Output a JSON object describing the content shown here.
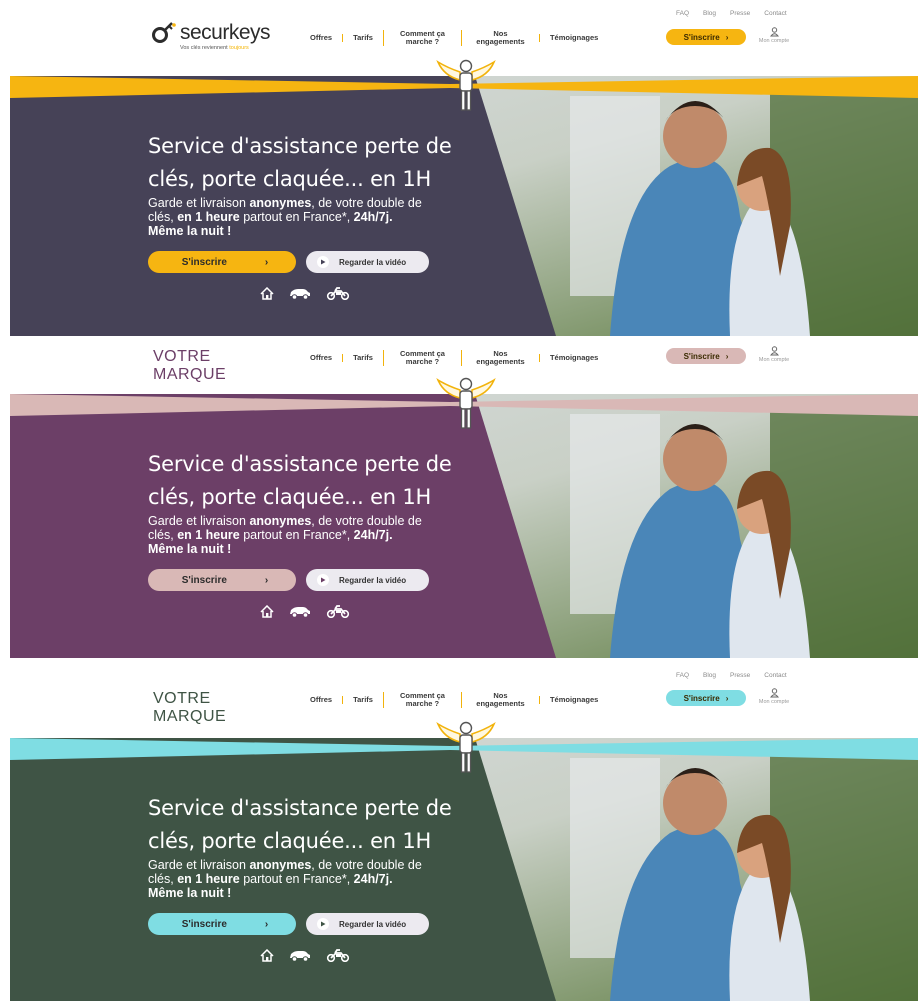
{
  "panels": [
    {
      "id": "securkeys",
      "accent": "#f6b511",
      "hero_bg": "#464257",
      "topnav": [
        "FAQ",
        "Blog",
        "Presse",
        "Contact"
      ],
      "logo": {
        "word": "securkeys",
        "tagline": "Vos clés reviennent",
        "tagline_accent": "toujours"
      },
      "nav": [
        "Offres",
        "Tarifs",
        "Comment ça marche ?",
        "Nos engagements",
        "Témoignages"
      ],
      "cta": "S'inscrire",
      "cta_arrow": "›",
      "account": "Mon compte",
      "hero": {
        "title_line1": "Service d'assistance perte de",
        "title_line2": "clés, porte claquée... en 1H",
        "sub_a": "Garde et livraison ",
        "sub_b": "anonymes",
        "sub_c": ", de votre double de",
        "sub_d": "clés, ",
        "sub_e": "en 1 heure",
        "sub_f": " partout en France*, ",
        "sub_g": "24h/7j.",
        "sub_h": "Même la nuit !",
        "btn_signup": "S'inscrire",
        "btn_signup_arrow": "›",
        "btn_video": "Regarder la vidéo"
      },
      "icons": [
        "home-icon",
        "car-icon",
        "motorbike-icon"
      ]
    },
    {
      "id": "votre-marque-purple",
      "accent": "#d9b8b6",
      "hero_bg": "#6c3f67",
      "brand": [
        "VOTRE",
        "MARQUE"
      ],
      "brand_color": "#6c3f67",
      "nav": [
        "Offres",
        "Tarifs",
        "Comment ça marche ?",
        "Nos engagements",
        "Témoignages"
      ],
      "cta": "S'inscrire",
      "cta_arrow": "›",
      "account": "Mon compte",
      "hero": {
        "title_line1": "Service d'assistance perte de",
        "title_line2": "clés, porte claquée... en 1H",
        "sub_a": "Garde et livraison ",
        "sub_b": "anonymes",
        "sub_c": ", de votre double de",
        "sub_d": "clés, ",
        "sub_e": "en 1 heure",
        "sub_f": " partout en France*, ",
        "sub_g": "24h/7j.",
        "sub_h": "Même la nuit !",
        "btn_signup": "S'inscrire",
        "btn_signup_arrow": "›",
        "btn_video": "Regarder la vidéo"
      },
      "icons": [
        "home-icon",
        "car-icon",
        "motorbike-icon"
      ]
    },
    {
      "id": "votre-marque-green",
      "accent": "#7fdde3",
      "hero_bg": "#3f5445",
      "brand": [
        "VOTRE",
        "MARQUE"
      ],
      "brand_color": "#3f5445",
      "topnav": [
        "FAQ",
        "Blog",
        "Presse",
        "Contact"
      ],
      "nav": [
        "Offres",
        "Tarifs",
        "Comment ça marche ?",
        "Nos engagements",
        "Témoignages"
      ],
      "cta": "S'inscrire",
      "cta_arrow": "›",
      "account": "Mon compte",
      "hero": {
        "title_line1": "Service d'assistance perte de",
        "title_line2": "clés, porte claquée... en 1H",
        "sub_a": "Garde et livraison ",
        "sub_b": "anonymes",
        "sub_c": ", de votre double de",
        "sub_d": "clés, ",
        "sub_e": "en 1 heure",
        "sub_f": " partout en France*, ",
        "sub_g": "24h/7j.",
        "sub_h": "Même la nuit !",
        "btn_signup": "S'inscrire",
        "btn_signup_arrow": "›",
        "btn_video": "Regarder la vidéo"
      },
      "icons": [
        "home-icon",
        "car-icon",
        "motorbike-icon"
      ]
    }
  ]
}
